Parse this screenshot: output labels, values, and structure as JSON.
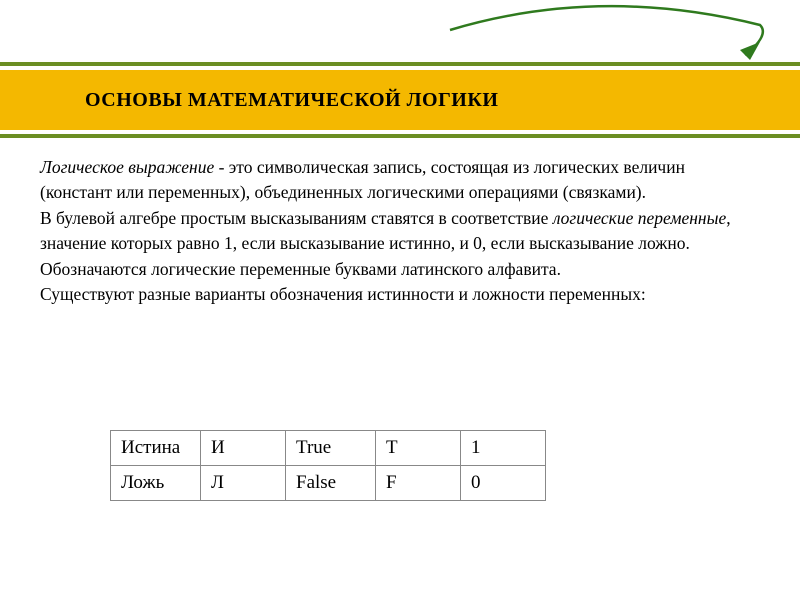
{
  "title": "ОСНОВЫ МАТЕМАТИЧЕСКОЙ ЛОГИКИ",
  "para1_italic": "Логическое выражение",
  "para1_rest": " - это символическая запись, состоящая из логических величин (констант или переменных), объединенных логическими операциями (связками).",
  "para2_before": "    В булевой алгебре простым высказываниям ставятся в соответствие ",
  "para2_italic": "логические переменные",
  "para2_after": ", значение которых равно 1, если высказывание истинно, и 0, если высказывание ложно. Обозначаются логические переменные буквами латинского алфавита.",
  "para3": "    Существуют разные варианты обозначения истинности и ложности переменных:",
  "table": {
    "rows": [
      [
        "Истина",
        "И",
        "True",
        "T",
        "1"
      ],
      [
        "Ложь",
        "Л",
        "False",
        "F",
        "0"
      ]
    ]
  }
}
